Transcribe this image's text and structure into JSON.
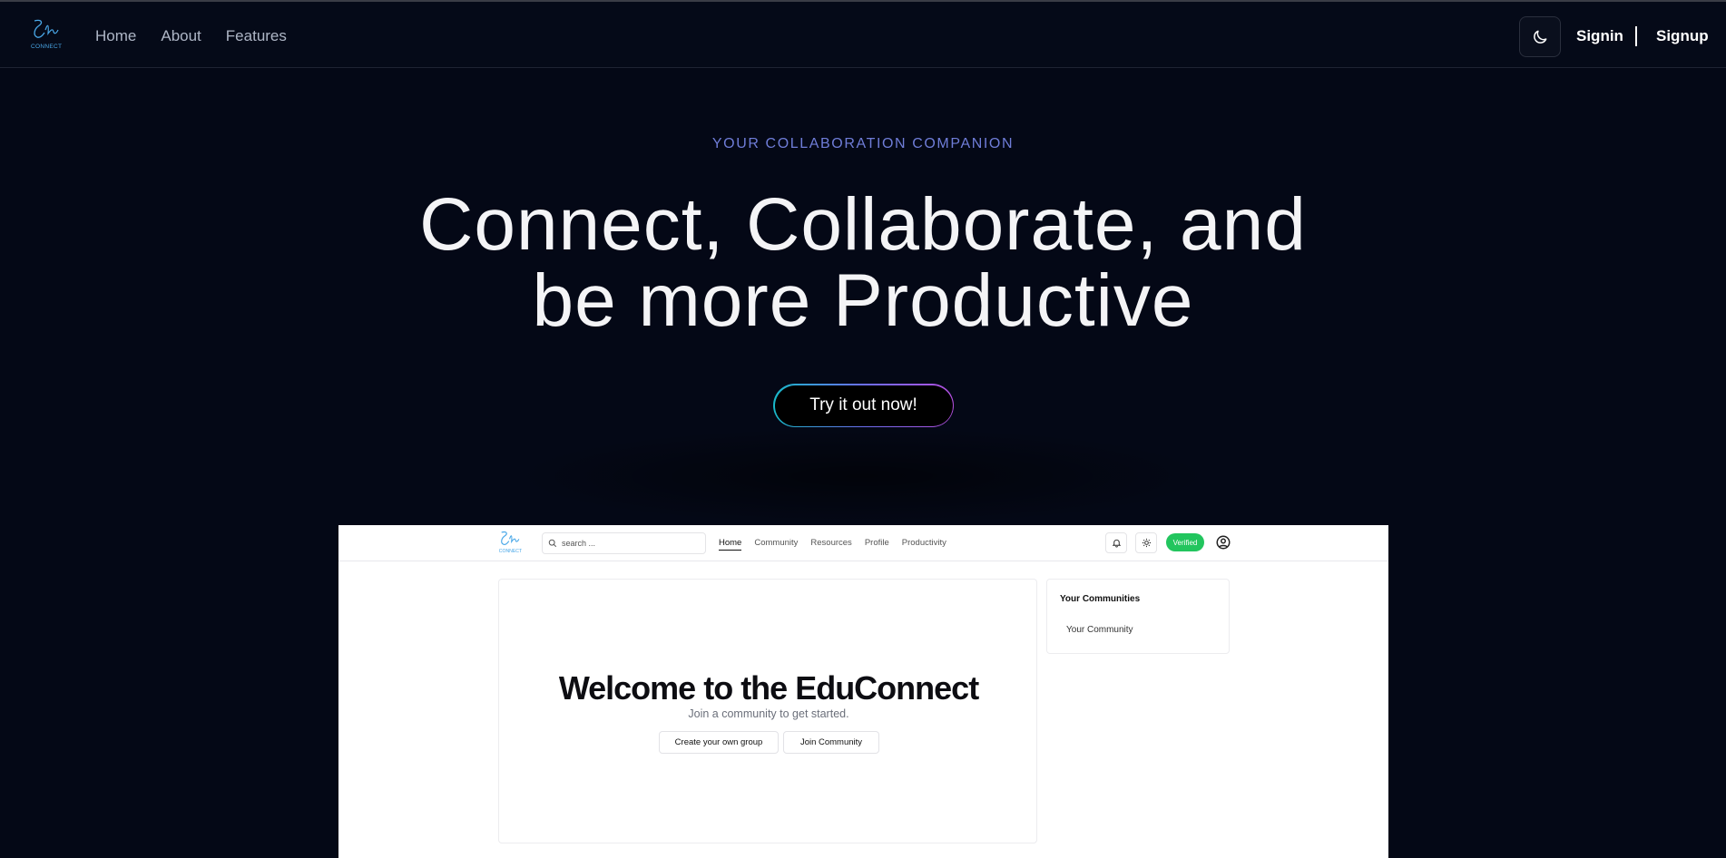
{
  "header": {
    "nav": [
      "Home",
      "About",
      "Features"
    ],
    "signin": "Signin",
    "signup": "Signup",
    "logo_text": "Edu CONNECT"
  },
  "hero": {
    "eyebrow": "YOUR COLLABORATION COMPANION",
    "headline_line1": "Connect, Collaborate, and",
    "headline_line2": "be more Productive",
    "cta": "Try it out now!"
  },
  "preview": {
    "search_placeholder": "search ...",
    "nav": [
      "Home",
      "Community",
      "Resources",
      "Profile",
      "Productivity"
    ],
    "badge": "Verified",
    "welcome_title": "Welcome to the EduConnect",
    "welcome_sub": "Join a community to get started.",
    "create_button": "Create your own group",
    "join_button": "Join Community",
    "sidebar_title": "Your Communities",
    "sidebar_item": "Your Community"
  },
  "colors": {
    "background": "#040816",
    "eyebrow": "#6f7dd8",
    "verified": "#22c55e"
  }
}
